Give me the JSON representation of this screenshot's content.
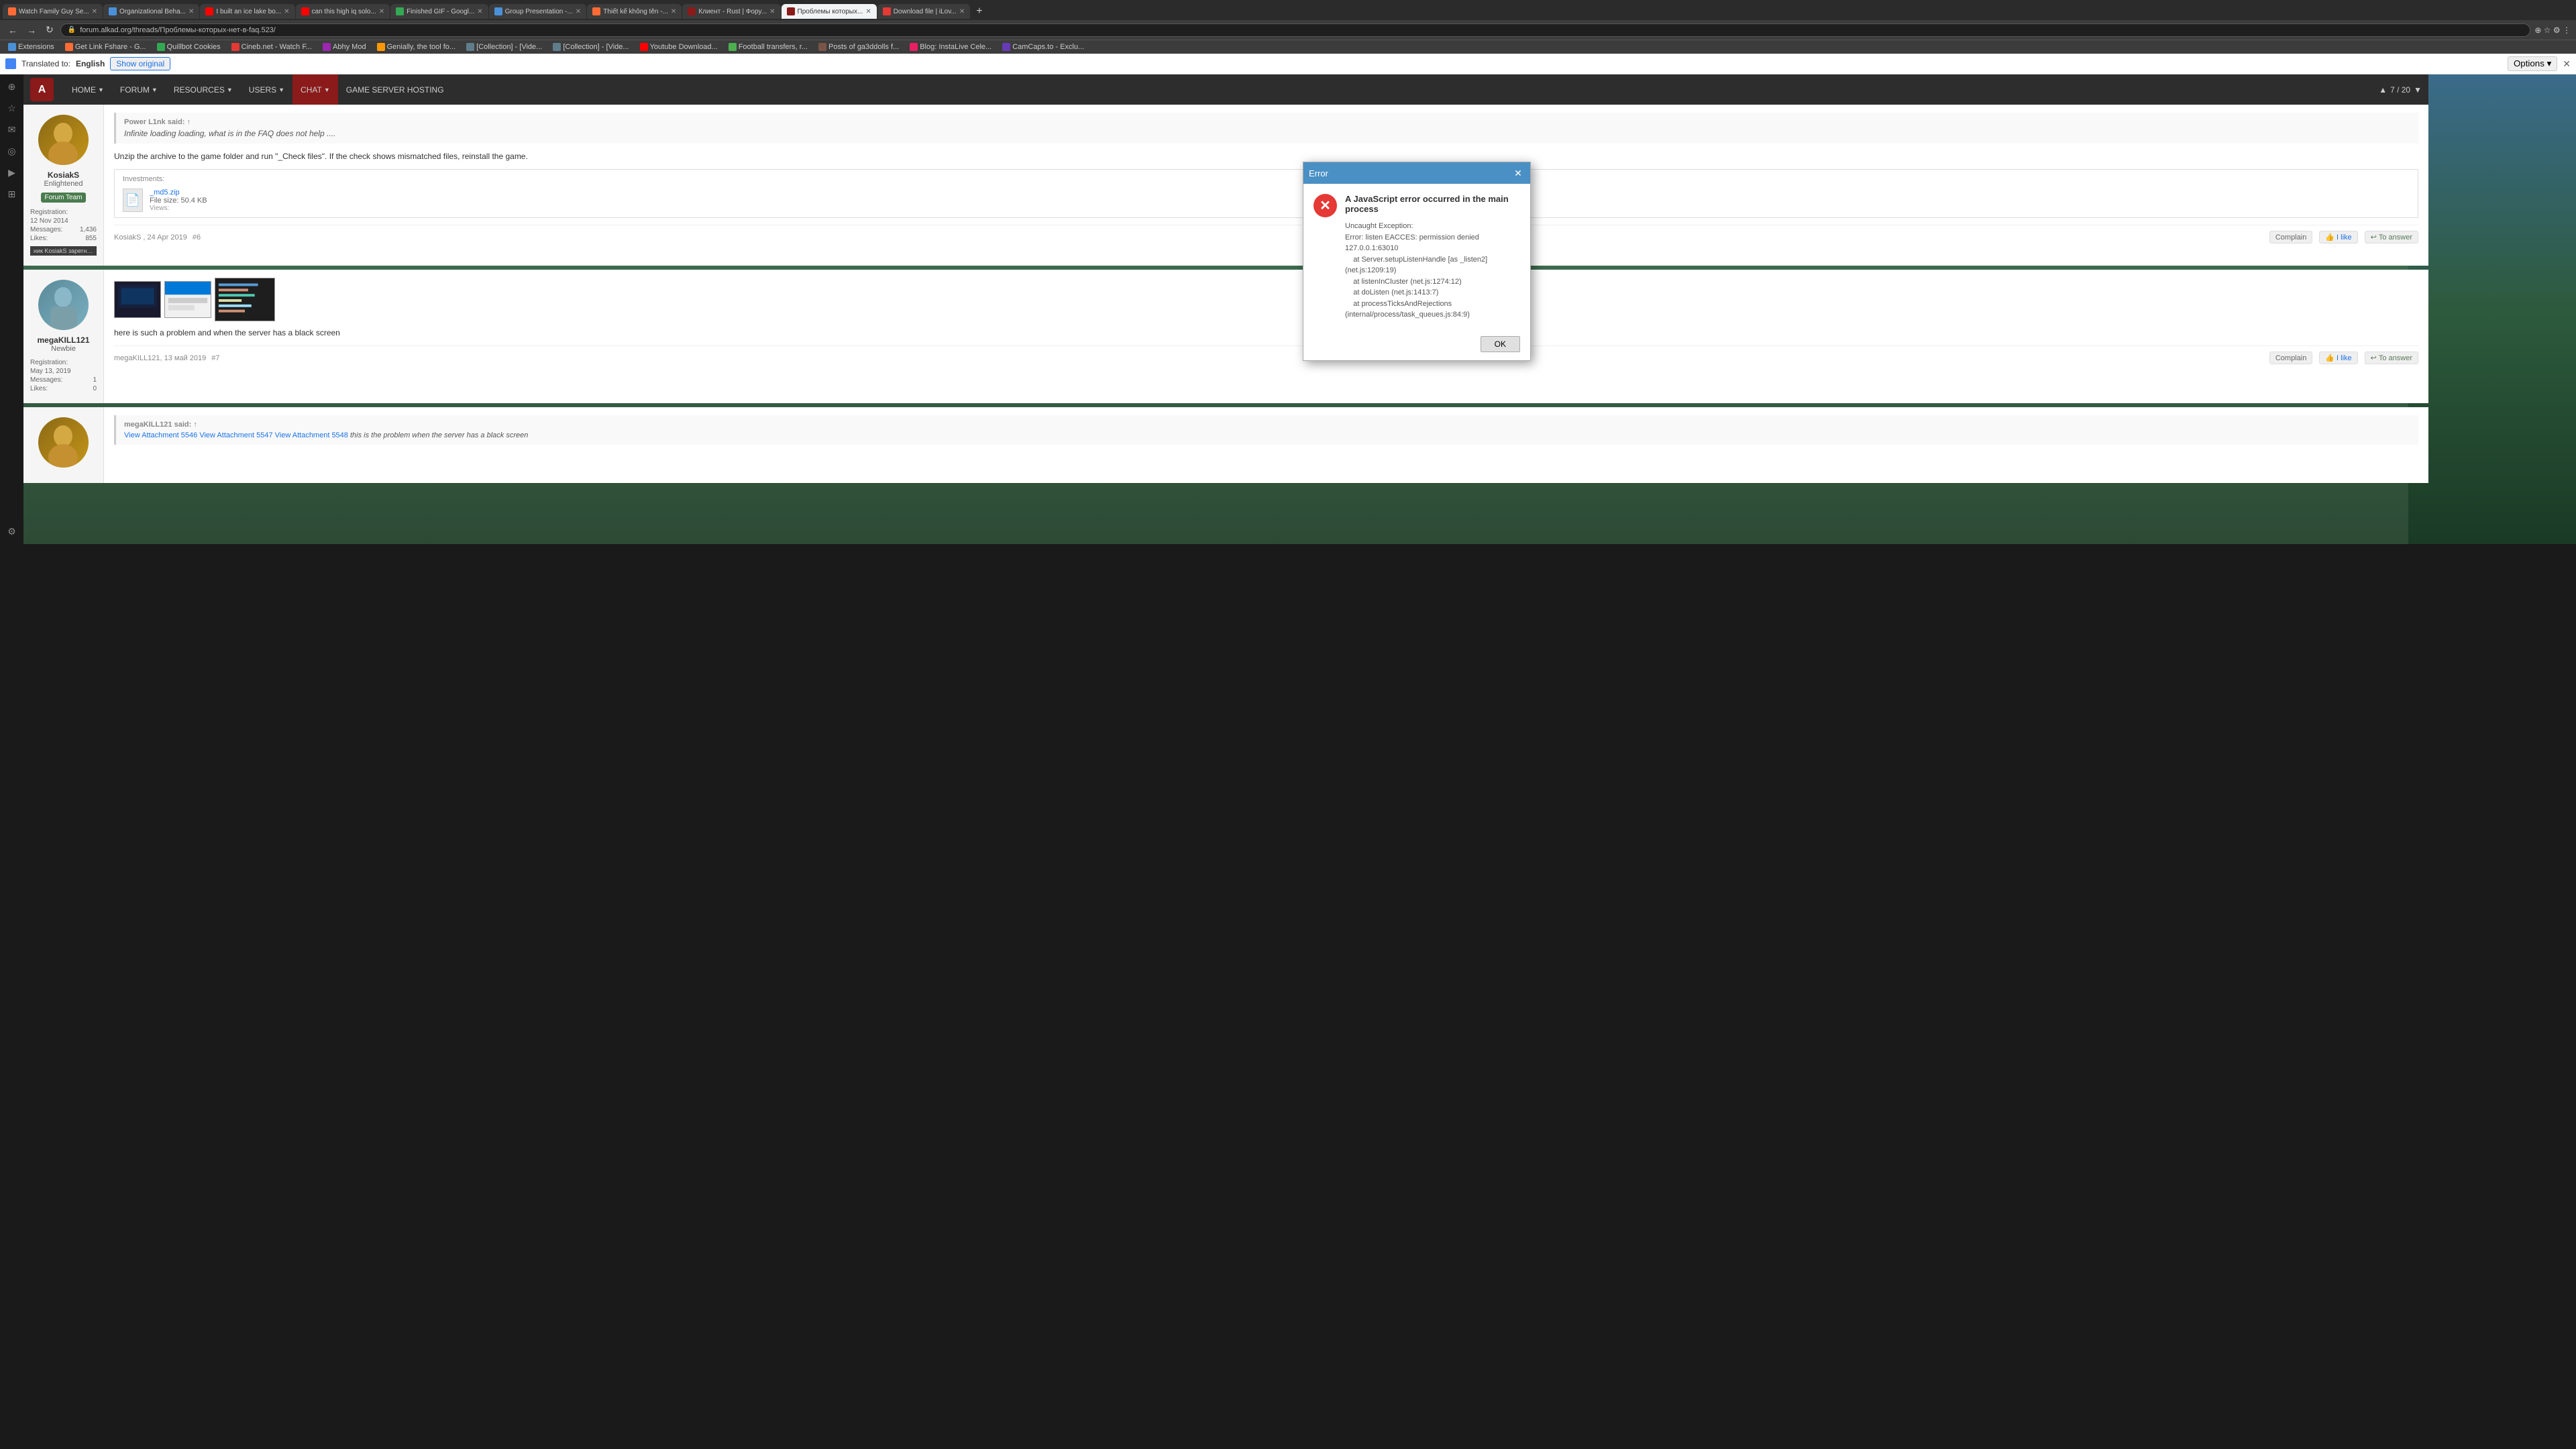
{
  "browser": {
    "tabs": [
      {
        "id": 1,
        "title": "Watch Family Guy Se...",
        "active": false,
        "favicon_color": "#ff6b35"
      },
      {
        "id": 2,
        "title": "Organizational Beha...",
        "active": false,
        "favicon_color": "#4a90d9"
      },
      {
        "id": 3,
        "title": "I built an ice lake bo...",
        "active": false,
        "favicon_color": "#ff0000"
      },
      {
        "id": 4,
        "title": "can this high iq solo...",
        "active": false,
        "favicon_color": "#ff0000"
      },
      {
        "id": 5,
        "title": "Finished GIF - Googl...",
        "active": false,
        "favicon_color": "#34a853"
      },
      {
        "id": 6,
        "title": "Group Presentation -...",
        "active": false,
        "favicon_color": "#4a90d9"
      },
      {
        "id": 7,
        "title": "Thiết kế không tên -...",
        "active": false,
        "favicon_color": "#ff6b35"
      },
      {
        "id": 8,
        "title": "Клиент - Rust | Форy...",
        "active": false,
        "favicon_color": "#8b1a1a"
      },
      {
        "id": 9,
        "title": "Проблемы которых...",
        "active": true,
        "favicon_color": "#8b1a1a"
      },
      {
        "id": 10,
        "title": "Download file | iLov...",
        "active": false,
        "favicon_color": "#e53935"
      }
    ],
    "url": "forum.alkad.org/threads/Проблемы-которых-нет-в-faq.523/",
    "translate_text": "Translated to:",
    "translate_lang": "English",
    "show_original": "Show original",
    "options_label": "Options ▾",
    "close_translate": "✕"
  },
  "bookmarks": [
    {
      "label": "Extensions"
    },
    {
      "label": "Get Link Fshare - G..."
    },
    {
      "label": "Quillbot Cookies"
    },
    {
      "label": "Cineb.net - Watch F..."
    },
    {
      "label": "Abhy Mod"
    },
    {
      "label": "Genially, the tool fo..."
    },
    {
      "label": "[Collection] - [Vide..."
    },
    {
      "label": "[Collection] - [Vide..."
    },
    {
      "label": "Youtube Download..."
    },
    {
      "label": "Football transfers, r..."
    },
    {
      "label": "Posts of ga3ddolls f..."
    },
    {
      "label": "Blog: InstaLive Cele..."
    },
    {
      "label": "CamCaps.to - Exclu..."
    }
  ],
  "nav": {
    "logo": "A",
    "items": [
      {
        "label": "HOME",
        "arrow": true
      },
      {
        "label": "FORUM",
        "arrow": true
      },
      {
        "label": "RESOURCES",
        "arrow": true
      },
      {
        "label": "USERS",
        "arrow": true
      },
      {
        "label": "CHAT",
        "arrow": true
      },
      {
        "label": "GAME SERVER HOSTING",
        "arrow": false
      }
    ],
    "counter": "7 / 20"
  },
  "post6": {
    "user": {
      "name": "KosiakS",
      "role": "Enlightened",
      "badge": "Forum Team",
      "reg_label": "Registration:",
      "reg_date": "12 Nov 2014",
      "msg_label": "Messages:",
      "msg_count": "1,436",
      "likes_label": "Likes:",
      "likes_count": "855",
      "tag": "ник KosiakS зарегнотрип"
    },
    "quote": {
      "author": "Power L1nk said: ↑",
      "text": "Infinite loading loading, what is in the FAQ does not help ...."
    },
    "text": "Unzip the archive to the game folder and run \"_Check files\". If the check shows mismatched files, reinstall the game.",
    "attachments_label": "Investments:",
    "attach": {
      "filename": "_md5.zip",
      "size_label": "File size:",
      "size": "50.4 KB",
      "views_label": "Views:"
    },
    "date": "KosiakS , 24 Apr 2019",
    "post_num": "#6",
    "complain": "Complain",
    "like": "I like",
    "answer": "To answer"
  },
  "post7": {
    "user": {
      "name": "megaKILL121",
      "role": "Newbie",
      "reg_label": "Registration:",
      "reg_date": "May 13, 2019",
      "msg_label": "Messages:",
      "msg_count": "1",
      "likes_label": "Likes:",
      "likes_count": "0"
    },
    "text": "here is such a problem and when the server has a black screen",
    "date": "megaKILL121, 13 май 2019",
    "post_num": "#7",
    "complain": "Complain",
    "like": "I like",
    "answer": "To answer"
  },
  "post8": {
    "quote_author": "megaKILL121 said: ↑",
    "quote_link1": "View Attachment 5546",
    "quote_link2": "View Attachment 5547",
    "quote_link3": "View Attachment 5548",
    "quote_text": "this is the problem when the server has a black screen"
  },
  "error_dialog": {
    "title": "Error",
    "close": "✕",
    "error_icon": "✕",
    "heading": "A JavaScript error occurred in the main process",
    "body": "Uncaught Exception:\nError: listen EACCES: permission denied 127.0.0.1:63010\n    at Server.setupListenHandle [as _listen2] (net.js:1209:19)\n    at listenInCluster (net.js:1274:12)\n    at doListen (net.js:1413:7)\n    at processTicksAndRejections (internal/process/task_queues.js:84:9)",
    "ok_label": "OK"
  }
}
